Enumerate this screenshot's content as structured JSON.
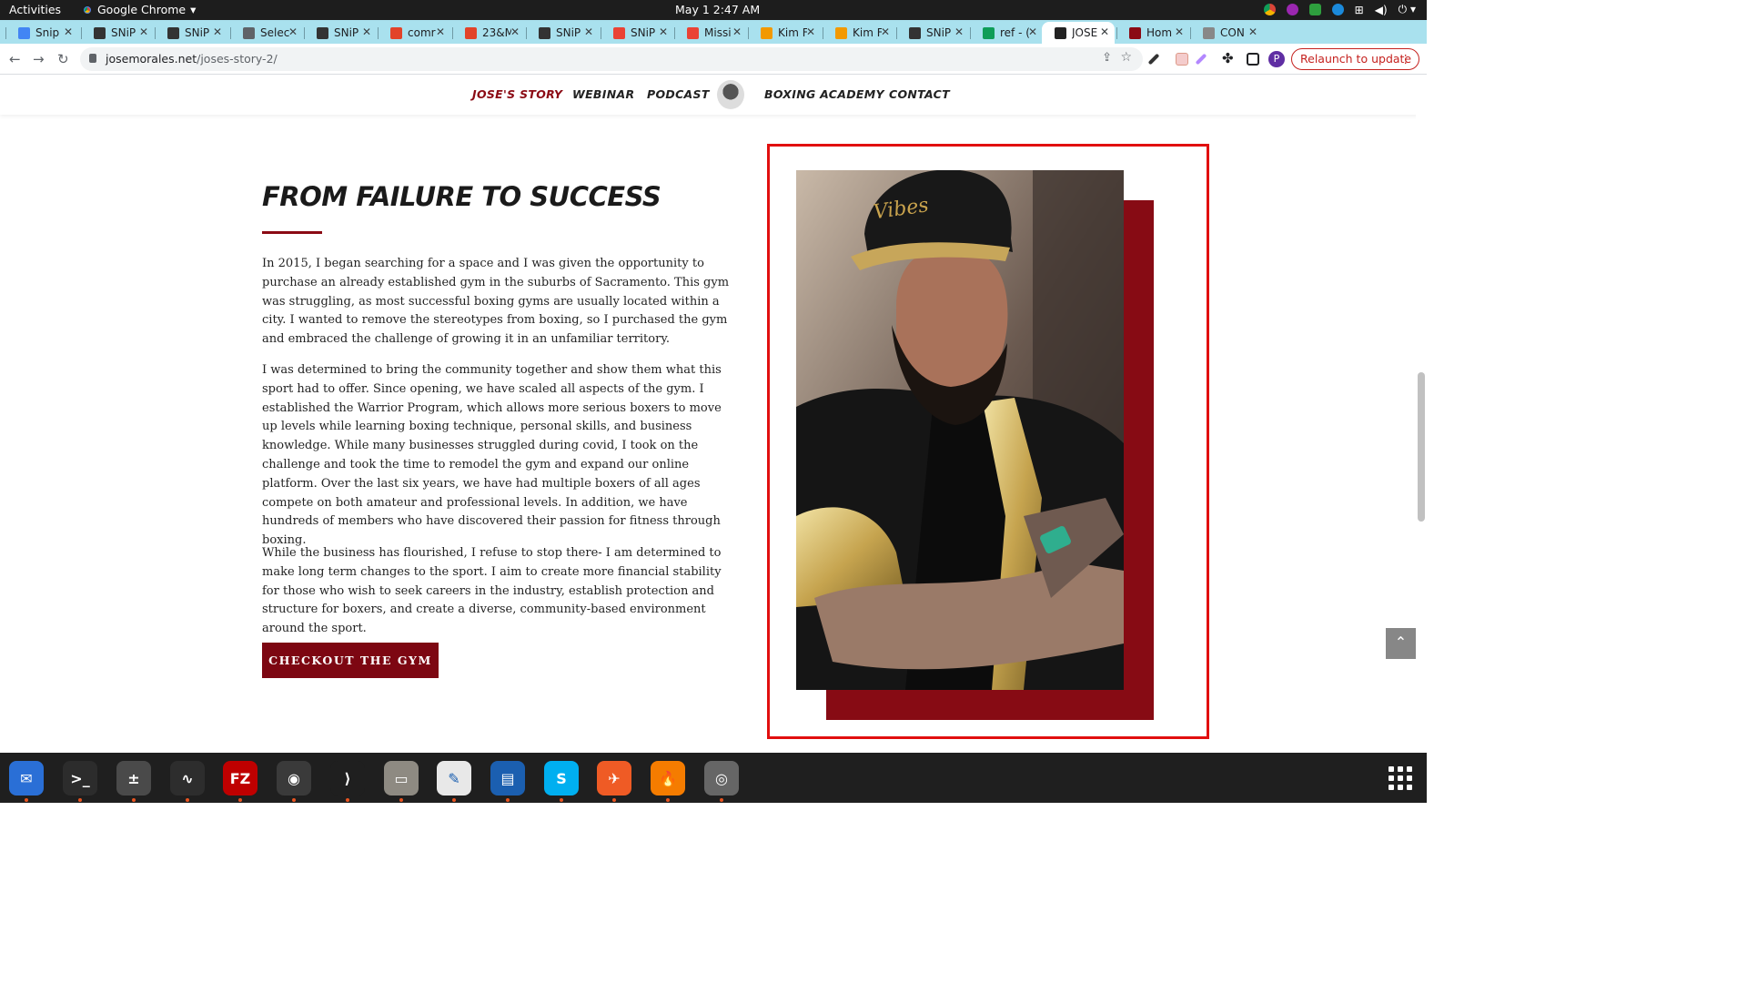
{
  "system": {
    "activities": "Activities",
    "app_name": "Google Chrome",
    "clock": "May 1  2:47 AM"
  },
  "tabs": [
    {
      "label": "Snip",
      "favicon_color": "#4285f4",
      "icon": "docs-icon"
    },
    {
      "label": "SNiP",
      "favicon_color": "#333333",
      "icon": "snip-icon"
    },
    {
      "label": "SNiP",
      "favicon_color": "#333333",
      "icon": "snip-icon"
    },
    {
      "label": "Selec",
      "favicon_color": "#5f6368",
      "icon": "globe-icon"
    },
    {
      "label": "SNiP",
      "favicon_color": "#333333",
      "icon": "snip-icon"
    },
    {
      "label": "comr",
      "favicon_color": "#e24329",
      "icon": "gitlab-icon"
    },
    {
      "label": "23&M",
      "favicon_color": "#e24329",
      "icon": "gitlab-icon"
    },
    {
      "label": "SNiP",
      "favicon_color": "#333333",
      "icon": "snip-icon"
    },
    {
      "label": "SNiP",
      "favicon_color": "#ea4335",
      "icon": "snip-icon"
    },
    {
      "label": "Missi",
      "favicon_color": "#ea4335",
      "icon": "app-icon"
    },
    {
      "label": "Kim F",
      "favicon_color": "#f29900",
      "icon": "app-icon"
    },
    {
      "label": "Kim F",
      "favicon_color": "#f29900",
      "icon": "app-icon"
    },
    {
      "label": "SNiP",
      "favicon_color": "#333333",
      "icon": "snip-icon"
    },
    {
      "label": "ref - (",
      "favicon_color": "#0f9d58",
      "icon": "sheets-icon"
    },
    {
      "label": "JOSE",
      "favicon_color": "#222222",
      "icon": "site-icon",
      "active": true
    },
    {
      "label": "Hom",
      "favicon_color": "#8b0a14",
      "icon": "site-icon"
    },
    {
      "label": "CON",
      "favicon_color": "#888888",
      "icon": "globe-icon"
    }
  ],
  "browser": {
    "url_host": "josemorales.net",
    "url_path": "/joses-story-2/",
    "relaunch_label": "Relaunch to update",
    "profile_initial": "P"
  },
  "site": {
    "nav": {
      "story": "JOSE'S STORY",
      "webinar": "WEBINAR",
      "podcast": "PODCAST",
      "academy": "BOXING ACADEMY",
      "contact": "CONTACT"
    },
    "heading": "FROM FAILURE TO SUCCESS",
    "paragraphs": [
      "In 2015, I began searching for a space and I was given the opportunity to purchase an already established gym in the suburbs of Sacramento. This gym was struggling, as most successful boxing gyms are usually located within a city. I wanted to remove the stereotypes from boxing, so I purchased the gym and embraced the challenge of growing it in an unfamiliar territory.",
      "I was determined to bring the community together and show them what this sport had to offer. Since opening, we have scaled all aspects of the gym. I established the Warrior Program, which allows more serious boxers to move up levels while learning boxing technique, personal skills, and business knowledge. While many businesses struggled during covid, I took on the challenge and took the time to remodel the gym and expand our online platform. Over the last six years, we have had multiple boxers of all ages compete on both amateur and professional levels. In addition, we have hundreds of members who have discovered their passion for fitness through boxing.",
      "While the business has flourished, I refuse to stop there- I am determined to make long term changes to the sport. I aim to create more financial stability for those who wish to seek careers in the industry, establish protection and structure for boxers, and create a diverse, community-based environment around the sport."
    ],
    "cta": "CHECKOUT THE GYM",
    "accent": "#8b0a14"
  },
  "dock": [
    {
      "name": "thunderbird",
      "color": "#2a6fd6"
    },
    {
      "name": "terminal",
      "color": "#2c2c2c"
    },
    {
      "name": "calculator",
      "color": "#4a4a4a"
    },
    {
      "name": "system-monitor",
      "color": "#2d2d2d"
    },
    {
      "name": "filezilla",
      "color": "#bf0000"
    },
    {
      "name": "chrome",
      "color": "#3a3a3a"
    },
    {
      "name": "vscode",
      "color": "#1f1f1f"
    },
    {
      "name": "files",
      "color": "#8e8a82"
    },
    {
      "name": "text-editor",
      "color": "#e8e8e8"
    },
    {
      "name": "writer",
      "color": "#1b5fb0"
    },
    {
      "name": "skype",
      "color": "#00aff0"
    },
    {
      "name": "postman",
      "color": "#ef5b25"
    },
    {
      "name": "blender-fire",
      "color": "#f57c00"
    },
    {
      "name": "disk-utility",
      "color": "#666666"
    }
  ]
}
